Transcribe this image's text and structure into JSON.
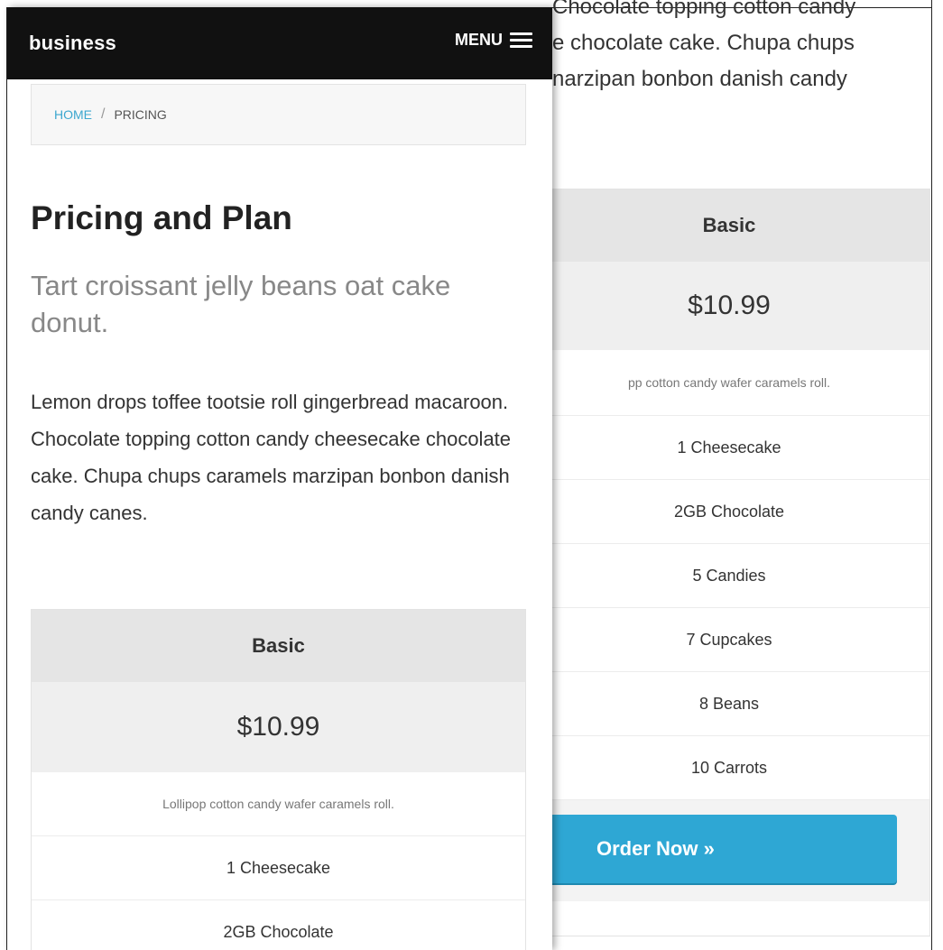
{
  "navbar": {
    "brand": "business",
    "menu_label": "MENU"
  },
  "breadcrumb": {
    "home": "HOME",
    "separator": "/",
    "current": "PRICING"
  },
  "page": {
    "title": "Pricing and Plan",
    "lead": "Tart croissant jelly beans oat cake donut.",
    "body": "Lemon drops toffee tootsie roll gingerbread macaroon. Chocolate topping cotton candy cheesecake chocolate cake. Chupa chups caramels marzipan bonbon danish candy canes."
  },
  "pricing_table": {
    "plan_name": "Basic",
    "price": "$10.99",
    "description": "Lollipop cotton candy wafer caramels roll.",
    "features": [
      "1 Cheesecake",
      "2GB Chocolate"
    ]
  },
  "background_page": {
    "intro_lines": [
      "Chocolate topping cotton candy",
      "e chocolate cake. Chupa chups",
      "narzipan bonbon danish candy"
    ],
    "plan_name": "Basic",
    "price": "$10.99",
    "description": "pp cotton candy wafer caramels roll.",
    "features": [
      "1 Cheesecake",
      "2GB Chocolate",
      "5 Candies",
      "7 Cupcakes",
      "8 Beans",
      "10 Carrots"
    ],
    "order_button": "Order Now »"
  },
  "colors": {
    "navbar_bg": "#111111",
    "link_accent": "#3ca7cf",
    "order_button": "#2ea7d4",
    "plan_header": "#e5e5e5",
    "price_row": "#efefef"
  },
  "icons": {
    "menu": "hamburger-icon"
  }
}
